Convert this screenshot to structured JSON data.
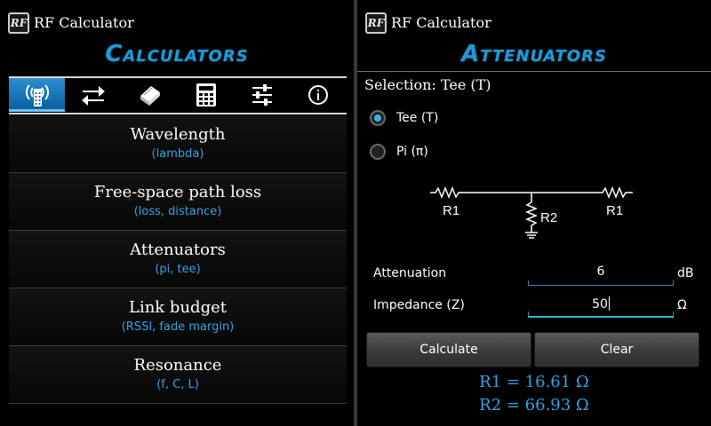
{
  "left": {
    "app_logo": "RF",
    "app_title": "RF Calculator",
    "section_title": "Calculators",
    "tabs": [
      {
        "icon": "antenna-icon",
        "active": true
      },
      {
        "icon": "convert-arrows-icon",
        "active": false
      },
      {
        "icon": "book-icon",
        "active": false
      },
      {
        "icon": "calculator-icon",
        "active": false
      },
      {
        "icon": "sliders-icon",
        "active": false
      },
      {
        "icon": "info-icon",
        "active": false
      }
    ],
    "items": [
      {
        "title": "Wavelength",
        "subtitle": "(lambda)"
      },
      {
        "title": "Free-space path loss",
        "subtitle": "(loss, distance)"
      },
      {
        "title": "Attenuators",
        "subtitle": "(pi, tee)"
      },
      {
        "title": "Link budget",
        "subtitle": "(RSSI, fade margin)"
      },
      {
        "title": "Resonance",
        "subtitle": "(f, C, L)"
      }
    ]
  },
  "right": {
    "app_logo": "RF",
    "app_title": "RF Calculator",
    "section_title": "Attenuators",
    "selection": "Selection: Tee (T)",
    "options": [
      {
        "label": "Tee (T)",
        "selected": true
      },
      {
        "label": "Pi (π)",
        "selected": false
      }
    ],
    "schematic": {
      "left": "R1",
      "right": "R1",
      "shunt": "R2"
    },
    "attenuation": {
      "label": "Attenuation",
      "value": "6",
      "unit": "dB"
    },
    "impedance": {
      "label": "Impedance (Z)",
      "value": "50",
      "unit": "Ω"
    },
    "calculate_label": "Calculate",
    "clear_label": "Clear",
    "results": [
      "R1 = 16.61 Ω",
      "R2 = 66.93 Ω"
    ]
  },
  "colors": {
    "accent": "#1e9ad6",
    "result": "#2fa6e6",
    "tab_active": "#1a7fc4"
  }
}
